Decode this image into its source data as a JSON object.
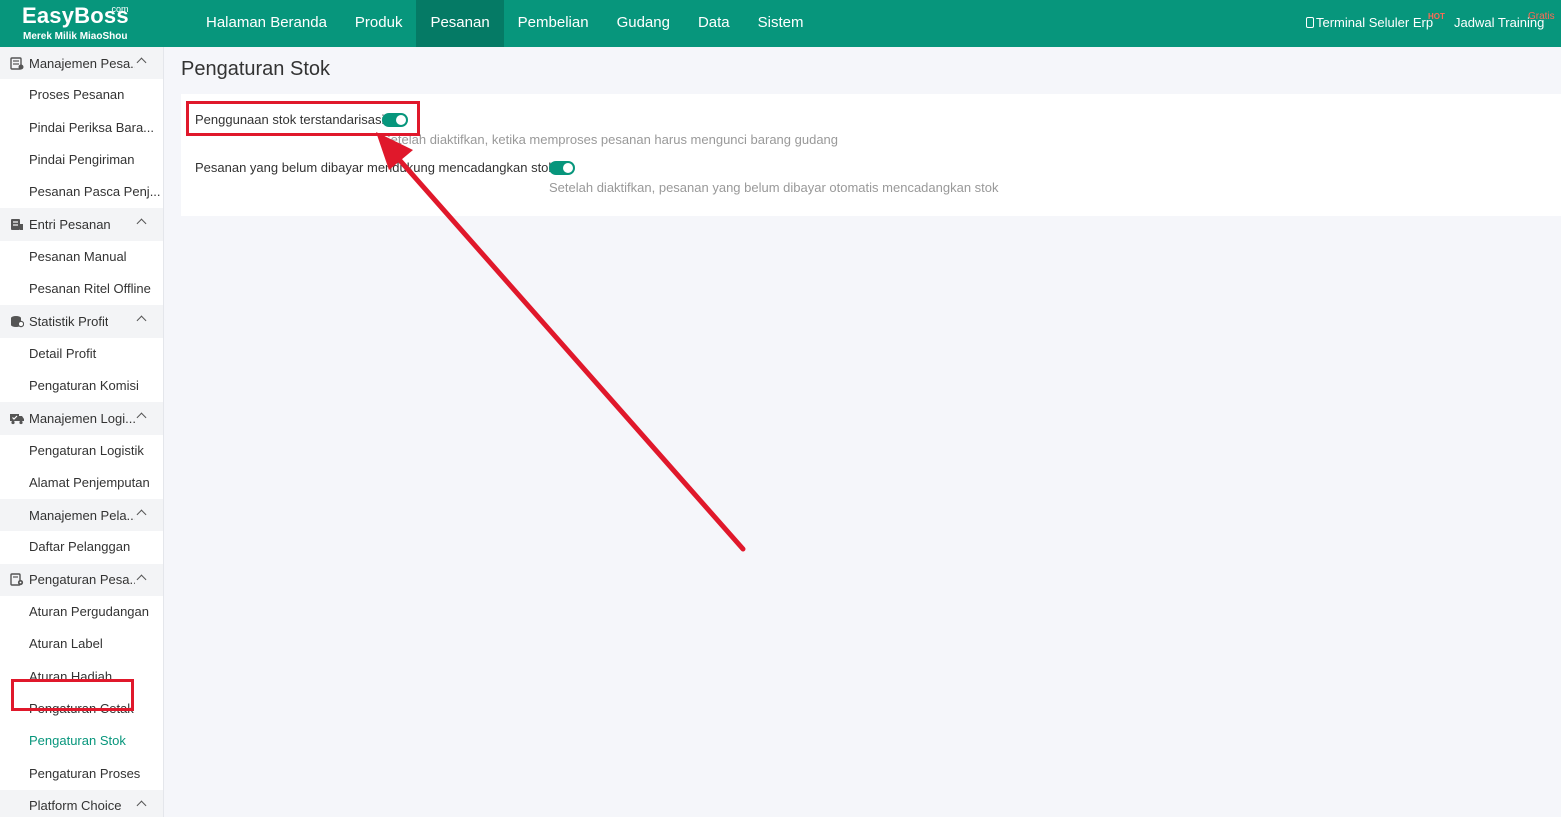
{
  "brand": {
    "logo_main": "EasyBoss",
    "logo_com": ".com",
    "logo_sub": "Merek Milik MiaoShou"
  },
  "nav": {
    "items": [
      "Halaman Beranda",
      "Produk",
      "Pesanan",
      "Pembelian",
      "Gudang",
      "Data",
      "Sistem"
    ],
    "active": "Pesanan"
  },
  "top_right": {
    "terminal_label": "Terminal Seluler Erp",
    "terminal_badge": "HOT",
    "training_label": "Jadwal Training",
    "training_badge": "Gratis"
  },
  "sidebar": {
    "groups": [
      {
        "label": "Manajemen Pesa...",
        "icon": "order-management-icon",
        "items": [
          "Proses Pesanan",
          "Pindai Periksa Bara...",
          "Pindai Pengiriman",
          "Pesanan Pasca Penj..."
        ]
      },
      {
        "label": "Entri Pesanan",
        "icon": "order-entry-icon",
        "items": [
          "Pesanan Manual",
          "Pesanan Ritel Offline"
        ]
      },
      {
        "label": "Statistik Profit",
        "icon": "profit-statistics-icon",
        "items": [
          "Detail Profit",
          "Pengaturan Komisi"
        ]
      },
      {
        "label": "Manajemen Logi...",
        "icon": "logistics-icon",
        "items": [
          "Pengaturan Logistik",
          "Alamat Penjemputan"
        ]
      },
      {
        "label": "Manajemen Pela...",
        "icon": "",
        "items": [
          "Daftar Pelanggan"
        ]
      },
      {
        "label": "Pengaturan Pesa...",
        "icon": "order-settings-icon",
        "items": [
          "Aturan Pergudangan",
          "Aturan Label",
          "Aturan Hadiah",
          "Pengaturan Cetak",
          "Pengaturan Stok",
          "Pengaturan Proses"
        ]
      },
      {
        "label": "Platform Choice",
        "icon": "",
        "items": []
      }
    ],
    "active_item": "Pengaturan Stok"
  },
  "main": {
    "title": "Pengaturan Stok",
    "settings": [
      {
        "label": "Penggunaan stok terstandarisasi:",
        "enabled": true,
        "description": "Setelah diaktifkan, ketika memproses pesanan harus mengunci barang gudang"
      },
      {
        "label": "Pesanan yang belum dibayar mendukung mencadangkan stok",
        "enabled": true,
        "description": "Setelah diaktifkan, pesanan yang belum dibayar otomatis mencadangkan stok"
      }
    ]
  },
  "colors": {
    "brand": "#07967c",
    "nav_active": "#057a65",
    "highlight": "#e0182b",
    "badge": "#ff6a55"
  }
}
